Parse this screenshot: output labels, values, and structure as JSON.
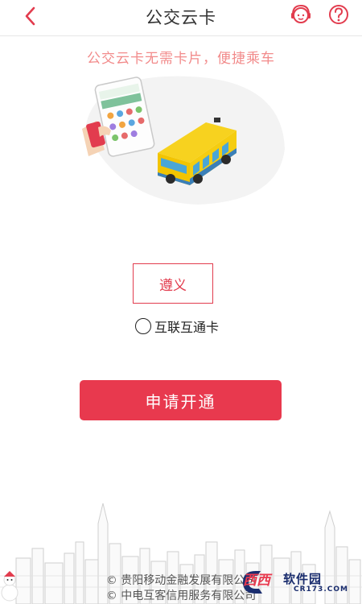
{
  "header": {
    "title": "公交云卡",
    "back_icon": "chevron-left-icon",
    "service_icon": "customer-service-icon",
    "help_icon": "question-circle-icon"
  },
  "slogan": "公交云卡无需卡片，便捷乘车",
  "city_button": {
    "label": "遵义"
  },
  "interconnect_option": {
    "label": "互联互通卡",
    "checked": false
  },
  "apply_button": {
    "label": "申请开通"
  },
  "footer": {
    "line1": "© 贵阳移动金融发展有限公司",
    "line2": "© 中电互客信用服务有限公司"
  },
  "watermark": {
    "brand": "西西",
    "text": "软件园",
    "sub": "CR173.COM"
  },
  "colors": {
    "accent": "#e8394e",
    "slogan": "#f28b8b",
    "back": "#e23c4e"
  }
}
